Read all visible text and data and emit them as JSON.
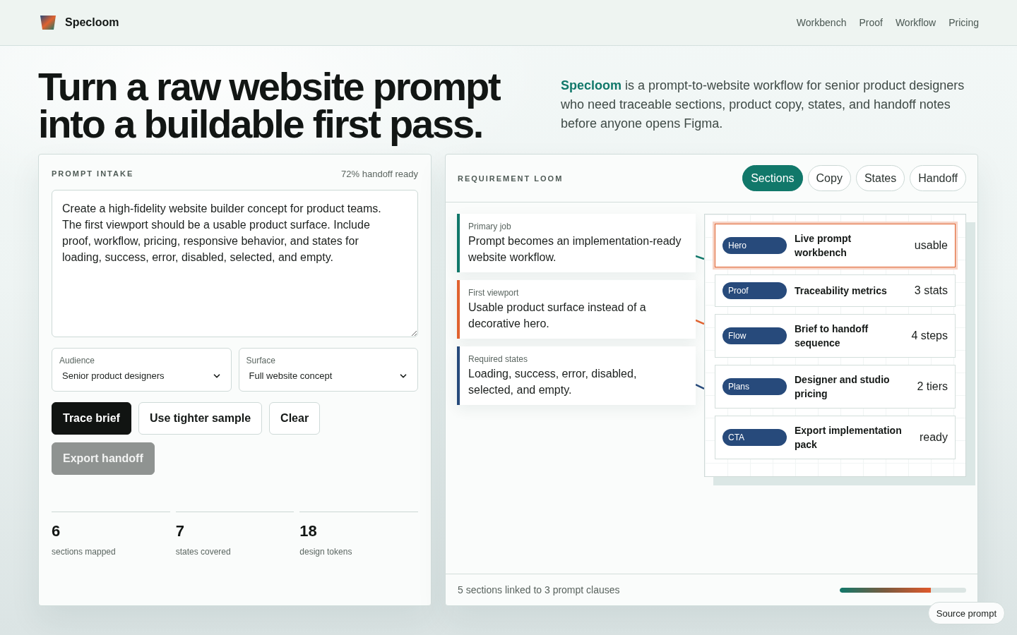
{
  "header": {
    "brand": "Specloom",
    "nav": [
      "Workbench",
      "Proof",
      "Workflow",
      "Pricing"
    ]
  },
  "hero": {
    "title": "Turn a raw website prompt into a buildable first pass.",
    "intro": "**Specloom** is a prompt-to-website workflow for senior product designers who need traceable sections, product copy, states, and handoff notes before anyone opens Figma."
  },
  "prompt_intake": {
    "title": "PROMPT INTAKE",
    "readiness": "72% handoff ready",
    "prompt": "Create a high-fidelity website builder concept for product teams. The first viewport should be a usable product surface. Include proof, workflow, pricing, responsive behavior, and states for loading, success, error, disabled, selected, and empty.",
    "selects": [
      {
        "label": "Audience",
        "value": "Senior product designers"
      },
      {
        "label": "Surface",
        "value": "Full website concept"
      }
    ],
    "buttons": [
      {
        "label": "Trace brief",
        "kind": "primary",
        "disabled": false
      },
      {
        "label": "Use tighter sample",
        "kind": "secondary",
        "disabled": false
      },
      {
        "label": "Clear",
        "kind": "secondary",
        "disabled": false
      },
      {
        "label": "Export handoff",
        "kind": "primary",
        "disabled": true
      }
    ],
    "stats": [
      {
        "value": "6",
        "label": "sections mapped"
      },
      {
        "value": "7",
        "label": "states covered"
      },
      {
        "value": "18",
        "label": "design tokens"
      }
    ]
  },
  "requirement_loom": {
    "title": "REQUIREMENT LOOM",
    "tabs": [
      {
        "label": "Sections",
        "selected": true
      },
      {
        "label": "Copy",
        "selected": false
      },
      {
        "label": "States",
        "selected": false
      },
      {
        "label": "Handoff",
        "selected": false
      }
    ],
    "clauses": [
      {
        "label": "Primary job",
        "text": "Prompt becomes an implementation-ready website workflow.",
        "color": "#11786a"
      },
      {
        "label": "First viewport",
        "text": "Usable product surface instead of a decorative hero.",
        "color": "#e0622f"
      },
      {
        "label": "Required states",
        "text": "Loading, success, error, disabled, selected, and empty.",
        "color": "#274a7b"
      }
    ],
    "sections": [
      {
        "tag": "Hero",
        "title": "Live prompt workbench",
        "value": "usable",
        "selected": true
      },
      {
        "tag": "Proof",
        "title": "Traceability metrics",
        "value": "3 stats",
        "selected": false
      },
      {
        "tag": "Flow",
        "title": "Brief to handoff sequence",
        "value": "4 steps",
        "selected": false
      },
      {
        "tag": "Plans",
        "title": "Designer and studio pricing",
        "value": "2 tiers",
        "selected": false
      },
      {
        "tag": "CTA",
        "title": "Export implementation pack",
        "value": "ready",
        "selected": false
      }
    ],
    "footer": {
      "summary": "5 sections linked to 3 prompt clauses",
      "progress": {
        "level": 0.72
      }
    }
  },
  "source_button": "Source prompt"
}
